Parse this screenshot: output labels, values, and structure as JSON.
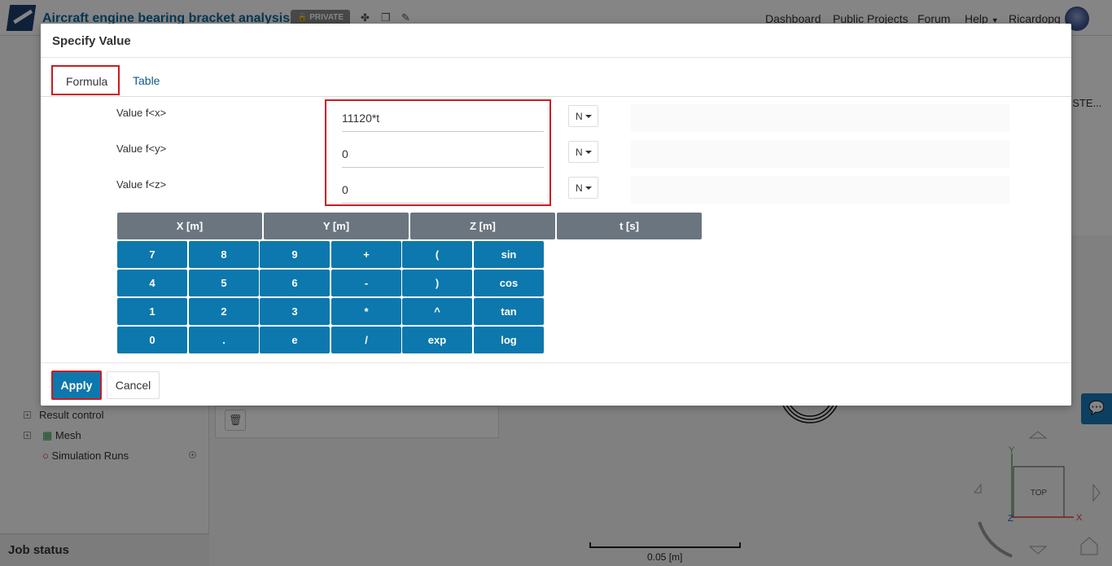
{
  "app": {
    "project_title": "Aircraft engine bearing bracket analysis",
    "private_label": "PRIVATE",
    "nav": [
      "Dashboard",
      "Public Projects",
      "Forum",
      "Help",
      "Ricardopg"
    ]
  },
  "sidebar": {
    "items": [
      {
        "label": "Result control"
      },
      {
        "label": "Mesh"
      },
      {
        "label": "Simulation Runs"
      }
    ],
    "job_status": "Job status"
  },
  "right_panel": {
    "truncated_text": "E STE..."
  },
  "viewport": {
    "scale_label": "0.05 [m]",
    "view_cube_label": "TOP",
    "axes": {
      "y": "Y",
      "x": "X",
      "z": "Z"
    }
  },
  "modal": {
    "title": "Specify Value",
    "tabs": [
      {
        "label": "Formula",
        "active": true
      },
      {
        "label": "Table",
        "active": false
      }
    ],
    "values": [
      {
        "label": "Value f<x>",
        "value": "11120*t",
        "unit": "N"
      },
      {
        "label": "Value f<y>",
        "value": "0",
        "unit": "N"
      },
      {
        "label": "Value f<z>",
        "value": "0",
        "unit": "N"
      }
    ],
    "variables": [
      "X [m]",
      "Y [m]",
      "Z [m]",
      "t [s]"
    ],
    "keypad": [
      [
        "7",
        "8",
        "9",
        "+",
        "(",
        "sin"
      ],
      [
        "4",
        "5",
        "6",
        "-",
        ")",
        "cos"
      ],
      [
        "1",
        "2",
        "3",
        "*",
        "^",
        "tan"
      ],
      [
        "0",
        ".",
        "e",
        "/",
        "exp",
        "log"
      ]
    ],
    "apply_label": "Apply",
    "cancel_label": "Cancel"
  },
  "colors": {
    "primary": "#0d78ad",
    "variable_button": "#6b757f",
    "highlight": "#d0181e",
    "chat_button": "#1a7ab8"
  },
  "icons": [
    "share-icon",
    "copy-icon",
    "edit-icon",
    "trash-icon",
    "chat-icon",
    "caret-down-icon"
  ]
}
